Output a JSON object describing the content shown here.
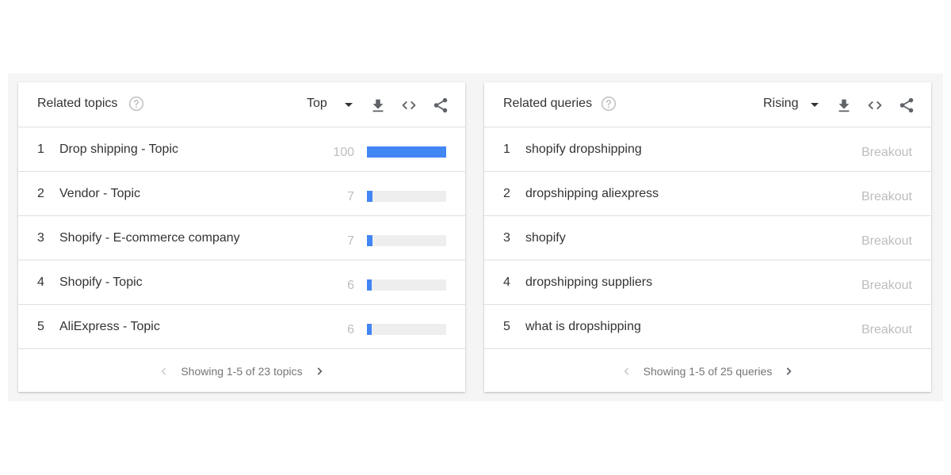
{
  "related_topics": {
    "title": "Related topics",
    "help_icon": "help-circle-icon",
    "selector": {
      "selected": "Top"
    },
    "tools": {
      "download": "download-icon",
      "embed": "code-icon",
      "share": "share-icon"
    },
    "items": [
      {
        "rank": "1",
        "label": "Drop shipping - Topic",
        "value": "100",
        "fraction": 1.0
      },
      {
        "rank": "2",
        "label": "Vendor - Topic",
        "value": "7",
        "fraction": 0.07
      },
      {
        "rank": "3",
        "label": "Shopify - E-commerce company",
        "value": "7",
        "fraction": 0.07
      },
      {
        "rank": "4",
        "label": "Shopify - Topic",
        "value": "6",
        "fraction": 0.06
      },
      {
        "rank": "5",
        "label": "AliExpress - Topic",
        "value": "6",
        "fraction": 0.06
      }
    ],
    "pager": {
      "text": "Showing 1-5 of 23 topics"
    },
    "colors": {
      "bar": "#4285f4",
      "track": "#eeeeee"
    }
  },
  "related_queries": {
    "title": "Related queries",
    "help_icon": "help-circle-icon",
    "selector": {
      "selected": "Rising"
    },
    "tools": {
      "download": "download-icon",
      "embed": "code-icon",
      "share": "share-icon"
    },
    "items": [
      {
        "rank": "1",
        "label": "shopify dropshipping",
        "value": "Breakout"
      },
      {
        "rank": "2",
        "label": "dropshipping aliexpress",
        "value": "Breakout"
      },
      {
        "rank": "3",
        "label": "shopify",
        "value": "Breakout"
      },
      {
        "rank": "4",
        "label": "dropshipping suppliers",
        "value": "Breakout"
      },
      {
        "rank": "5",
        "label": "what is dropshipping",
        "value": "Breakout"
      }
    ],
    "pager": {
      "text": "Showing 1-5 of 25 queries"
    }
  }
}
